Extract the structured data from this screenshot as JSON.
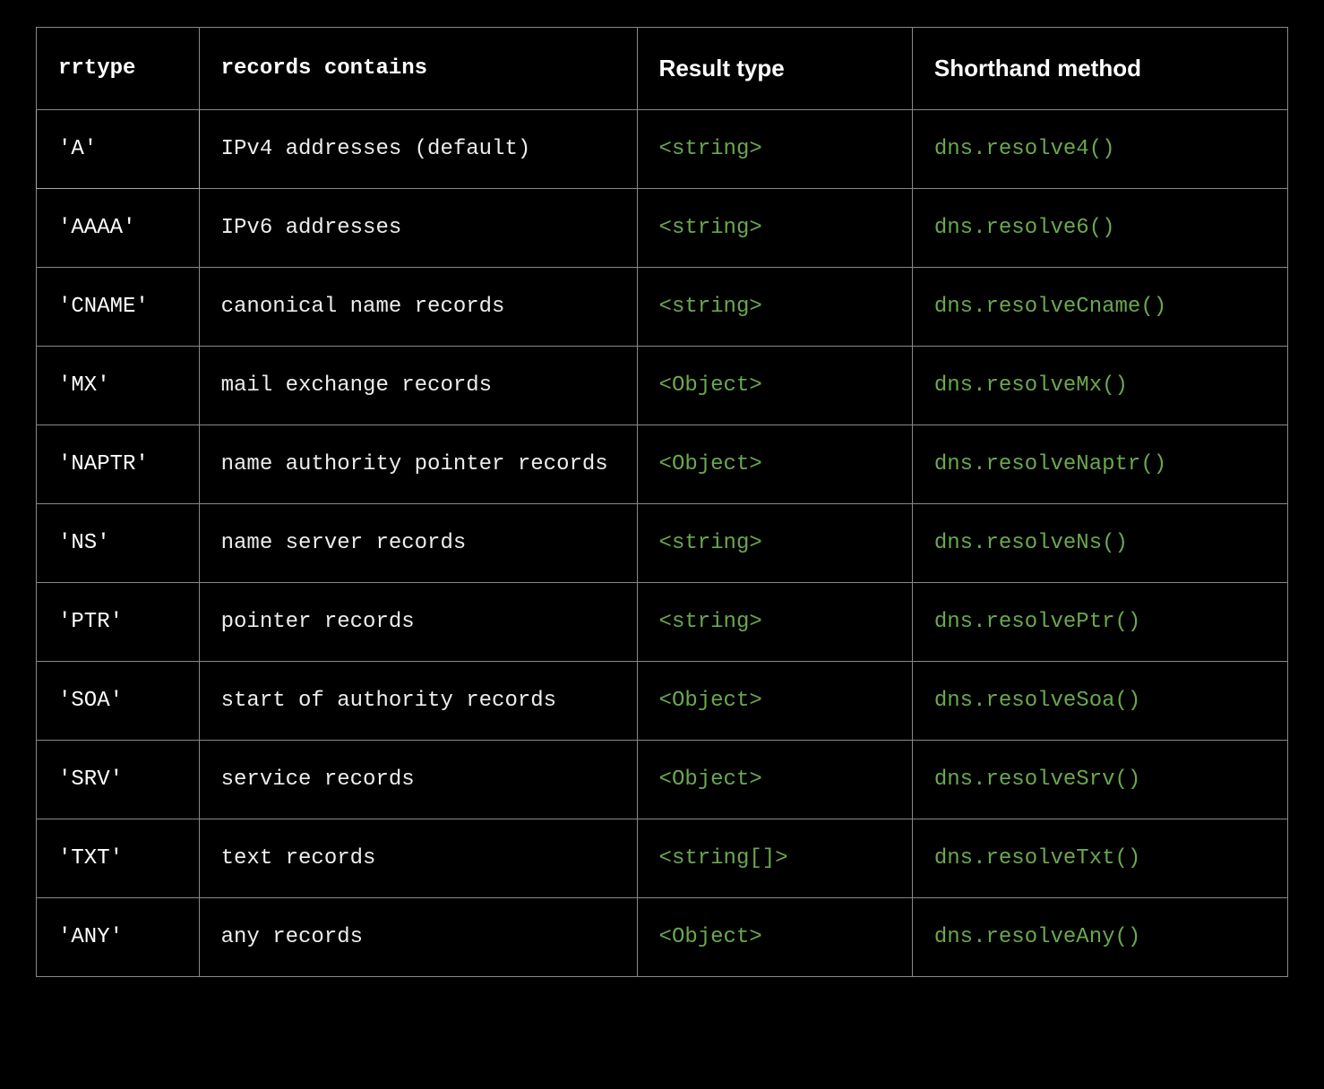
{
  "table": {
    "headers": {
      "rrtype": "rrtype",
      "records_contains": "records contains",
      "result_type": "Result type",
      "shorthand_method": "Shorthand method"
    },
    "rows": [
      {
        "rrtype": "'A'",
        "desc": "IPv4 addresses (default)",
        "result": "<string>",
        "shorthand": "dns.resolve4()"
      },
      {
        "rrtype": "'AAAA'",
        "desc": "IPv6 addresses",
        "result": "<string>",
        "shorthand": "dns.resolve6()"
      },
      {
        "rrtype": "'CNAME'",
        "desc": "canonical name records",
        "result": "<string>",
        "shorthand": "dns.resolveCname()"
      },
      {
        "rrtype": "'MX'",
        "desc": "mail exchange records",
        "result": "<Object>",
        "shorthand": "dns.resolveMx()"
      },
      {
        "rrtype": "'NAPTR'",
        "desc": "name authority pointer records",
        "result": "<Object>",
        "shorthand": "dns.resolveNaptr()"
      },
      {
        "rrtype": "'NS'",
        "desc": "name server records",
        "result": "<string>",
        "shorthand": "dns.resolveNs()"
      },
      {
        "rrtype": "'PTR'",
        "desc": "pointer records",
        "result": "<string>",
        "shorthand": "dns.resolvePtr()"
      },
      {
        "rrtype": "'SOA'",
        "desc": "start of authority records",
        "result": "<Object>",
        "shorthand": "dns.resolveSoa()"
      },
      {
        "rrtype": "'SRV'",
        "desc": "service records",
        "result": "<Object>",
        "shorthand": "dns.resolveSrv()"
      },
      {
        "rrtype": "'TXT'",
        "desc": "text records",
        "result": "<string[]>",
        "shorthand": "dns.resolveTxt()"
      },
      {
        "rrtype": "'ANY'",
        "desc": "any records",
        "result": "<Object>",
        "shorthand": "dns.resolveAny()"
      }
    ]
  }
}
